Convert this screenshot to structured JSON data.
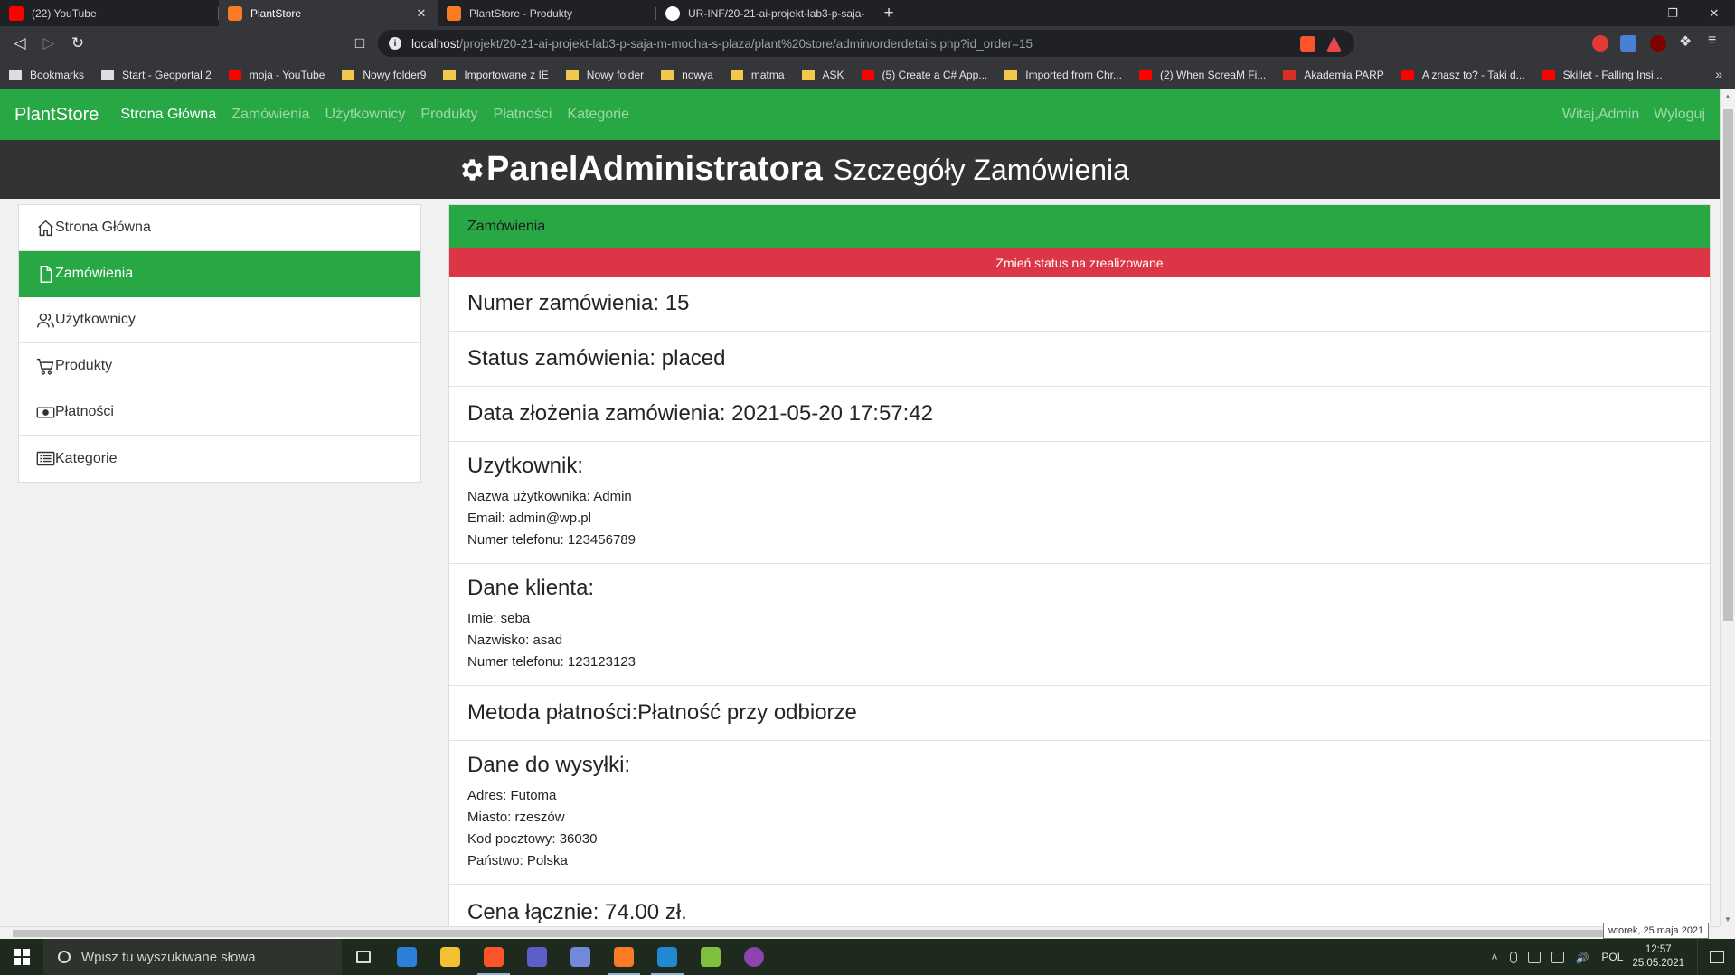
{
  "browser": {
    "tabs": [
      {
        "title": "(22) YouTube",
        "icon": "youtube-icon",
        "active": false
      },
      {
        "title": "PlantStore",
        "icon": "xampp-icon",
        "active": true
      },
      {
        "title": "PlantStore - Produkty",
        "icon": "xampp-icon",
        "active": false
      },
      {
        "title": "UR-INF/20-21-ai-projekt-lab3-p-saja-",
        "icon": "github-icon",
        "active": false
      }
    ],
    "tab_close": "✕",
    "new_tab": "+",
    "url_host": "localhost",
    "url_path": "/projekt/20-21-ai-projekt-lab3-p-saja-m-mocha-s-plaza/plant%20store/admin/orderdetails.php?id_order=15",
    "bookmarks": [
      {
        "label": "Bookmarks",
        "icon": "bookmarks-icon"
      },
      {
        "label": "Start - Geoportal 2",
        "icon": "page-icon"
      },
      {
        "label": "moja - YouTube",
        "icon": "youtube-icon"
      },
      {
        "label": "Nowy folder9",
        "icon": "folder-icon"
      },
      {
        "label": "Importowane z IE",
        "icon": "folder-icon"
      },
      {
        "label": "Nowy folder",
        "icon": "folder-icon"
      },
      {
        "label": "nowya",
        "icon": "folder-icon"
      },
      {
        "label": "matma",
        "icon": "folder-icon"
      },
      {
        "label": "ASK",
        "icon": "folder-icon"
      },
      {
        "label": "(5) Create a C# App...",
        "icon": "youtube-icon"
      },
      {
        "label": "Imported from Chr...",
        "icon": "folder-icon"
      },
      {
        "label": "(2) When ScreaM Fi...",
        "icon": "youtube-icon"
      },
      {
        "label": "Akademia PARP",
        "icon": "parp-icon"
      },
      {
        "label": "A znasz to? - Taki d...",
        "icon": "youtube-icon"
      },
      {
        "label": "Skillet - Falling Insi...",
        "icon": "youtube-icon"
      }
    ],
    "bookmarks_more": "»"
  },
  "site": {
    "brand": "PlantStore",
    "nav": [
      "Strona Główna",
      "Zamówienia",
      "Użytkownicy",
      "Produkty",
      "Płatności",
      "Kategorie"
    ],
    "nav_right": [
      "Witaj,Admin",
      "Wyloguj"
    ],
    "panel_title": "PanelAdministratora",
    "panel_subtitle": "Szczegóły Zamówienia"
  },
  "sidebar": [
    {
      "label": "Strona Główna",
      "icon": "home-icon"
    },
    {
      "label": "Zamówienia",
      "icon": "document-icon"
    },
    {
      "label": "Użytkownicy",
      "icon": "users-icon"
    },
    {
      "label": "Produkty",
      "icon": "cart-icon"
    },
    {
      "label": "Płatności",
      "icon": "cash-icon"
    },
    {
      "label": "Kategorie",
      "icon": "list-icon"
    }
  ],
  "order": {
    "panel_heading": "Zamówienia",
    "status_button": "Zmień status na zrealizowane",
    "number": "Numer zamówienia: 15",
    "status": "Status zamówienia: placed",
    "date": "Data złożenia zamówienia: 2021-05-20 17:57:42",
    "user": {
      "heading": "Uzytkownik:",
      "username": "Nazwa użytkownika: Admin",
      "email": "Email: admin@wp.pl",
      "phone": "Numer telefonu: 123456789"
    },
    "client": {
      "heading": "Dane klienta:",
      "first_name": "Imie: seba",
      "last_name": "Nazwisko: asad",
      "phone": "Numer telefonu: 123123123"
    },
    "payment": "Metoda płatności:Płatność przy odbiorze",
    "shipping": {
      "heading": "Dane do wysyłki:",
      "address": "Adres: Futoma",
      "city": "Miasto: rzeszów",
      "postal": "Kod pocztowy: 36030",
      "country": "Państwo: Polska"
    },
    "total": "Cena łącznie: 74.00 zł."
  },
  "tooltip": "wtorek, 25 maja 2021",
  "taskbar": {
    "search_placeholder": "Wpisz tu wyszukiwane słowa",
    "lang": "POL",
    "time": "12:57",
    "date": "25.05.2021"
  },
  "colors": {
    "accent_green": "#28a745",
    "danger_red": "#dc3545",
    "header_dark": "#333333"
  }
}
